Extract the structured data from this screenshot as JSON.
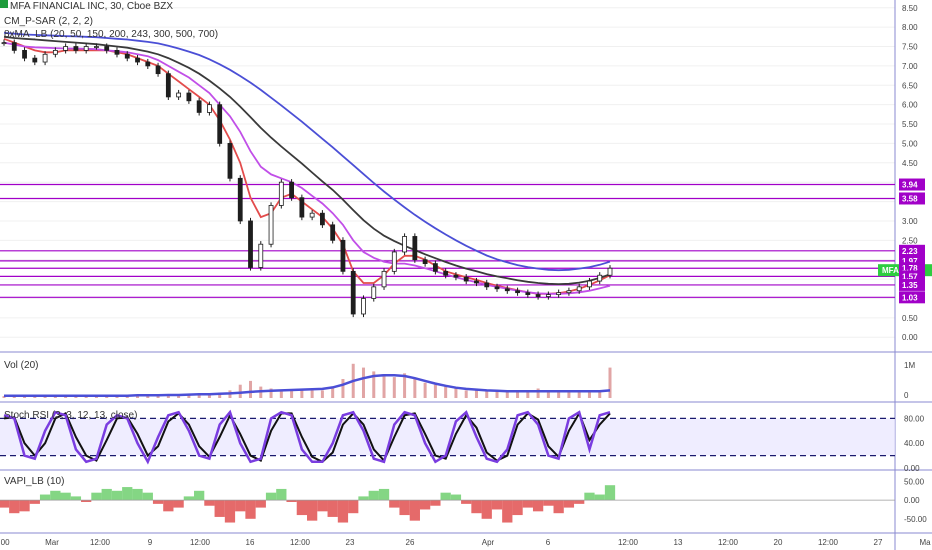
{
  "header": {
    "title": "MFA FINANCIAL INC, 30, Cboe BZX",
    "indicator_sar": "CM_P-SAR (2, 2, 2)",
    "indicator_ma": "8xMA_LB (20, 50, 150, 200, 243, 300, 500, 700)"
  },
  "panes": {
    "vol_label": "Vol (20)",
    "stoch_label": "Stoch RSI (3, 3, 12, 13, close)",
    "vapi_label": "VAPI_LB (10)"
  },
  "colors": {
    "sma_blue": "#4b4fd6",
    "sma_dark": "#3a3a3a",
    "sma_violet": "#c14fe8",
    "sma_red": "#e34c4c",
    "level_line": "#a100c8",
    "candle_up": "#1e1e1e",
    "candle_down": "#1e1e1e",
    "vapi_pos": "#6fcf6f",
    "vapi_neg": "#e05050",
    "stoch_k": "#7a3de0",
    "stoch_d": "#111111"
  },
  "chart_data": {
    "type": "line",
    "price_axis": {
      "ticks": [
        8.5,
        8.0,
        7.5,
        7.0,
        6.5,
        6.0,
        5.5,
        5.0,
        4.5,
        4.0,
        3.5,
        3.0,
        2.5,
        2.0,
        1.5,
        1.0,
        0.5,
        0.0
      ],
      "ylim": [
        -0.2,
        8.7
      ]
    },
    "x_labels": [
      ":00",
      "Mar",
      "12:00",
      "9",
      "12:00",
      "16",
      "12:00",
      "23",
      "26",
      "Apr",
      "6",
      "12:00",
      "13",
      "12:00",
      "20",
      "12:00",
      "27",
      "Ma"
    ],
    "level_tags": [
      {
        "label": "3.94",
        "value": 3.94
      },
      {
        "label": "3.58",
        "value": 3.58
      },
      {
        "label": "2.23",
        "value": 2.23
      },
      {
        "label": "1.97",
        "value": 1.97
      },
      {
        "label": "1.78",
        "value": 1.78
      },
      {
        "label": "1.57",
        "value": 1.57
      },
      {
        "label": "1.35",
        "value": 1.35
      },
      {
        "label": "1.03",
        "value": 1.03
      }
    ],
    "last_price": {
      "label": "MFA",
      "value": "1.73"
    },
    "series": [
      {
        "name": "close",
        "values": [
          7.6,
          7.4,
          7.2,
          7.1,
          7.3,
          7.4,
          7.5,
          7.4,
          7.5,
          7.5,
          7.4,
          7.3,
          7.2,
          7.1,
          7.0,
          6.8,
          6.2,
          6.3,
          6.1,
          5.8,
          6.0,
          5.0,
          4.1,
          3.0,
          1.8,
          2.4,
          3.4,
          4.0,
          3.6,
          3.1,
          3.2,
          2.9,
          2.5,
          1.7,
          0.6,
          1.0,
          1.3,
          1.7,
          2.2,
          2.6,
          2.0,
          1.9,
          1.7,
          1.6,
          1.55,
          1.45,
          1.4,
          1.3,
          1.25,
          1.2,
          1.15,
          1.1,
          1.05,
          1.1,
          1.15,
          1.2,
          1.3,
          1.45,
          1.6,
          1.78
        ]
      },
      {
        "name": "ma_red",
        "values": [
          7.7,
          7.6,
          7.5,
          7.4,
          7.35,
          7.35,
          7.4,
          7.4,
          7.4,
          7.4,
          7.4,
          7.35,
          7.3,
          7.2,
          7.1,
          7.0,
          6.8,
          6.6,
          6.4,
          6.2,
          6.0,
          5.6,
          5.1,
          4.5,
          3.6,
          3.1,
          3.2,
          3.6,
          3.7,
          3.5,
          3.3,
          3.1,
          2.8,
          2.4,
          1.7,
          1.4,
          1.4,
          1.6,
          1.9,
          2.1,
          2.1,
          2.0,
          1.85,
          1.7,
          1.62,
          1.55,
          1.48,
          1.4,
          1.33,
          1.27,
          1.21,
          1.16,
          1.12,
          1.12,
          1.14,
          1.18,
          1.25,
          1.35,
          1.47,
          1.6
        ]
      },
      {
        "name": "ma_violet",
        "values": [
          7.6,
          7.55,
          7.5,
          7.48,
          7.47,
          7.46,
          7.45,
          7.45,
          7.44,
          7.43,
          7.4,
          7.38,
          7.35,
          7.3,
          7.25,
          7.15,
          7.0,
          6.85,
          6.7,
          6.5,
          6.3,
          6.0,
          5.7,
          5.3,
          4.8,
          4.4,
          4.2,
          4.1,
          4.0,
          3.85,
          3.65,
          3.45,
          3.2,
          2.9,
          2.5,
          2.2,
          2.05,
          1.95,
          1.9,
          1.9,
          1.85,
          1.78,
          1.7,
          1.62,
          1.55,
          1.48,
          1.42,
          1.35,
          1.3,
          1.25,
          1.2,
          1.16,
          1.13,
          1.12,
          1.12,
          1.13,
          1.16,
          1.2,
          1.26,
          1.33
        ]
      },
      {
        "name": "ma_dark",
        "values": [
          7.75,
          7.72,
          7.7,
          7.68,
          7.66,
          7.64,
          7.62,
          7.6,
          7.58,
          7.56,
          7.53,
          7.5,
          7.47,
          7.42,
          7.37,
          7.3,
          7.2,
          7.08,
          6.95,
          6.8,
          6.62,
          6.42,
          6.2,
          5.95,
          5.68,
          5.4,
          5.15,
          4.92,
          4.7,
          4.48,
          4.25,
          4.02,
          3.8,
          3.55,
          3.28,
          3.02,
          2.8,
          2.62,
          2.48,
          2.36,
          2.25,
          2.14,
          2.04,
          1.94,
          1.85,
          1.77,
          1.7,
          1.63,
          1.57,
          1.52,
          1.47,
          1.43,
          1.4,
          1.38,
          1.37,
          1.38,
          1.41,
          1.46,
          1.53,
          1.62
        ]
      },
      {
        "name": "ma_blue",
        "values": [
          7.85,
          7.83,
          7.81,
          7.8,
          7.79,
          7.78,
          7.77,
          7.76,
          7.75,
          7.74,
          7.72,
          7.7,
          7.68,
          7.65,
          7.62,
          7.58,
          7.52,
          7.45,
          7.37,
          7.28,
          7.17,
          7.04,
          6.9,
          6.74,
          6.57,
          6.38,
          6.18,
          5.98,
          5.77,
          5.56,
          5.34,
          5.12,
          4.9,
          4.67,
          4.44,
          4.21,
          3.98,
          3.76,
          3.55,
          3.35,
          3.16,
          2.98,
          2.81,
          2.65,
          2.5,
          2.36,
          2.23,
          2.11,
          2.01,
          1.93,
          1.86,
          1.81,
          1.77,
          1.74,
          1.73,
          1.74,
          1.77,
          1.81,
          1.87,
          1.95
        ]
      }
    ],
    "volume": {
      "ticks": [
        "1M",
        "0"
      ],
      "values": [
        0.05,
        0.05,
        0.06,
        0.05,
        0.05,
        0.06,
        0.05,
        0.05,
        0.06,
        0.05,
        0.05,
        0.06,
        0.06,
        0.07,
        0.06,
        0.08,
        0.1,
        0.1,
        0.1,
        0.12,
        0.1,
        0.14,
        0.2,
        0.35,
        0.45,
        0.3,
        0.25,
        0.2,
        0.2,
        0.25,
        0.2,
        0.2,
        0.3,
        0.5,
        0.9,
        0.8,
        0.7,
        0.6,
        0.55,
        0.65,
        0.5,
        0.4,
        0.35,
        0.3,
        0.25,
        0.2,
        0.2,
        0.18,
        0.16,
        0.2,
        0.15,
        0.2,
        0.25,
        0.15,
        0.2,
        0.15,
        0.2,
        0.18,
        0.2,
        0.8
      ],
      "avg": [
        0.06,
        0.06,
        0.06,
        0.06,
        0.06,
        0.06,
        0.06,
        0.06,
        0.06,
        0.06,
        0.06,
        0.06,
        0.06,
        0.07,
        0.07,
        0.07,
        0.08,
        0.08,
        0.09,
        0.1,
        0.1,
        0.11,
        0.12,
        0.14,
        0.16,
        0.18,
        0.19,
        0.2,
        0.21,
        0.22,
        0.23,
        0.24,
        0.28,
        0.35,
        0.45,
        0.52,
        0.58,
        0.6,
        0.6,
        0.58,
        0.52,
        0.45,
        0.38,
        0.32,
        0.27,
        0.24,
        0.22,
        0.2,
        0.19,
        0.18,
        0.18,
        0.18,
        0.18,
        0.18,
        0.18,
        0.18,
        0.18,
        0.18,
        0.18,
        0.2
      ]
    },
    "stoch": {
      "ticks": [
        "80.00",
        "40.00",
        "0.00"
      ],
      "levels": [
        80,
        20
      ],
      "k": [
        85,
        80,
        20,
        15,
        60,
        90,
        85,
        30,
        10,
        15,
        70,
        85,
        80,
        40,
        10,
        50,
        85,
        90,
        60,
        20,
        15,
        70,
        90,
        40,
        10,
        15,
        80,
        90,
        85,
        30,
        10,
        10,
        40,
        85,
        90,
        60,
        15,
        10,
        70,
        90,
        85,
        40,
        10,
        20,
        75,
        90,
        50,
        15,
        10,
        30,
        85,
        90,
        70,
        20,
        15,
        80,
        90,
        30,
        85,
        90
      ],
      "d": [
        80,
        82,
        40,
        20,
        40,
        80,
        88,
        50,
        20,
        12,
        45,
        80,
        82,
        55,
        20,
        35,
        75,
        88,
        70,
        35,
        18,
        50,
        85,
        55,
        20,
        12,
        60,
        88,
        88,
        50,
        18,
        10,
        25,
        70,
        88,
        70,
        30,
        12,
        50,
        85,
        88,
        55,
        20,
        15,
        55,
        85,
        65,
        25,
        12,
        20,
        70,
        88,
        78,
        35,
        18,
        60,
        88,
        45,
        70,
        88
      ]
    },
    "vapi": {
      "ticks": [
        "50.00",
        "0.00",
        "-50.00"
      ],
      "values": [
        -20,
        -35,
        -30,
        -10,
        15,
        25,
        20,
        10,
        -5,
        20,
        30,
        25,
        35,
        30,
        20,
        -10,
        -30,
        -20,
        10,
        25,
        -15,
        -45,
        -60,
        -30,
        -50,
        -20,
        20,
        30,
        -5,
        -40,
        -55,
        -30,
        -45,
        -60,
        -35,
        10,
        25,
        30,
        -20,
        -40,
        -55,
        -25,
        -15,
        20,
        15,
        -10,
        -35,
        -50,
        -25,
        -60,
        -40,
        -20,
        -30,
        -15,
        -35,
        -20,
        -10,
        20,
        15,
        40
      ]
    }
  }
}
